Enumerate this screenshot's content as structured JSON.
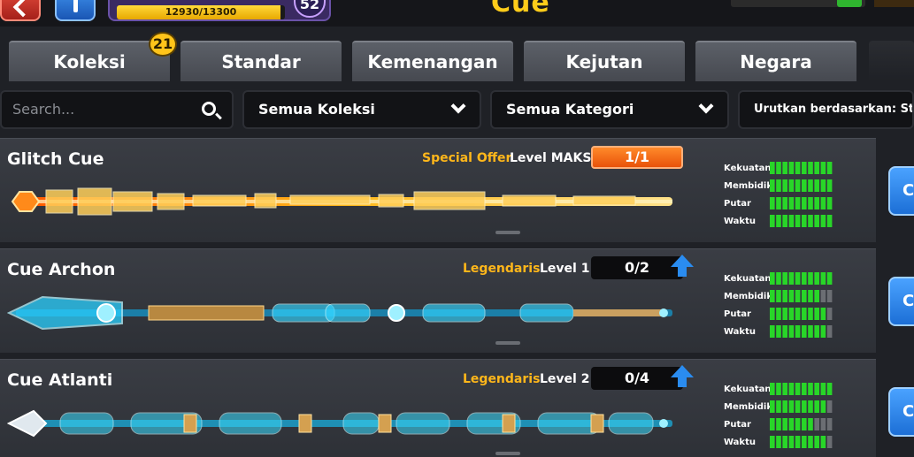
{
  "header": {
    "title": "Cue",
    "xp_text": "12930/13300",
    "xp_progress": 0.972,
    "player_level": "52"
  },
  "tabs": [
    {
      "label": "Koleksi",
      "badge": "21",
      "active": false
    },
    {
      "label": "Standar",
      "active": false
    },
    {
      "label": "Kemenangan",
      "active": false
    },
    {
      "label": "Kejutan",
      "active": false
    },
    {
      "label": "Negara",
      "active": false
    }
  ],
  "filters": {
    "search_placeholder": "Search...",
    "collection": "Semua Koleksi",
    "category": "Semua Kategori",
    "sort": "Urutkan berdasarkan: Stati"
  },
  "stat_labels": [
    "Kekuatan",
    "Membidik",
    "Putar",
    "Waktu"
  ],
  "cues": [
    {
      "name": "Glitch Cue",
      "tag": "Special Offer",
      "level": "Level MAKS",
      "count": "1/1",
      "maxed": true,
      "stats": [
        10,
        10,
        10,
        10
      ],
      "cta_label": "C",
      "theme": "glitch"
    },
    {
      "name": "Cue Archon",
      "tag": "Legendaris",
      "level": "Level 1",
      "count": "0/2",
      "maxed": false,
      "stats": [
        10,
        8,
        9,
        9
      ],
      "cta_label": "C",
      "theme": "archon"
    },
    {
      "name": "Cue Atlanti",
      "tag": "Legendaris",
      "level": "Level 2",
      "count": "0/4",
      "maxed": false,
      "stats": [
        10,
        9,
        7,
        9
      ],
      "cta_label": "C",
      "theme": "atlanti"
    }
  ],
  "colors": {
    "accent_yellow": "#ffb71a",
    "stat_green": "#28d628",
    "stat_empty": "#6b6e73",
    "maxed_orange": "#ff7a1a",
    "upgrade_blue": "#2a8cf0"
  },
  "icons": {
    "back": "chevron-left-icon",
    "info": "info-icon",
    "search": "search-icon",
    "dropdown": "chevron-down-icon",
    "upgrade": "arrow-up-icon"
  }
}
